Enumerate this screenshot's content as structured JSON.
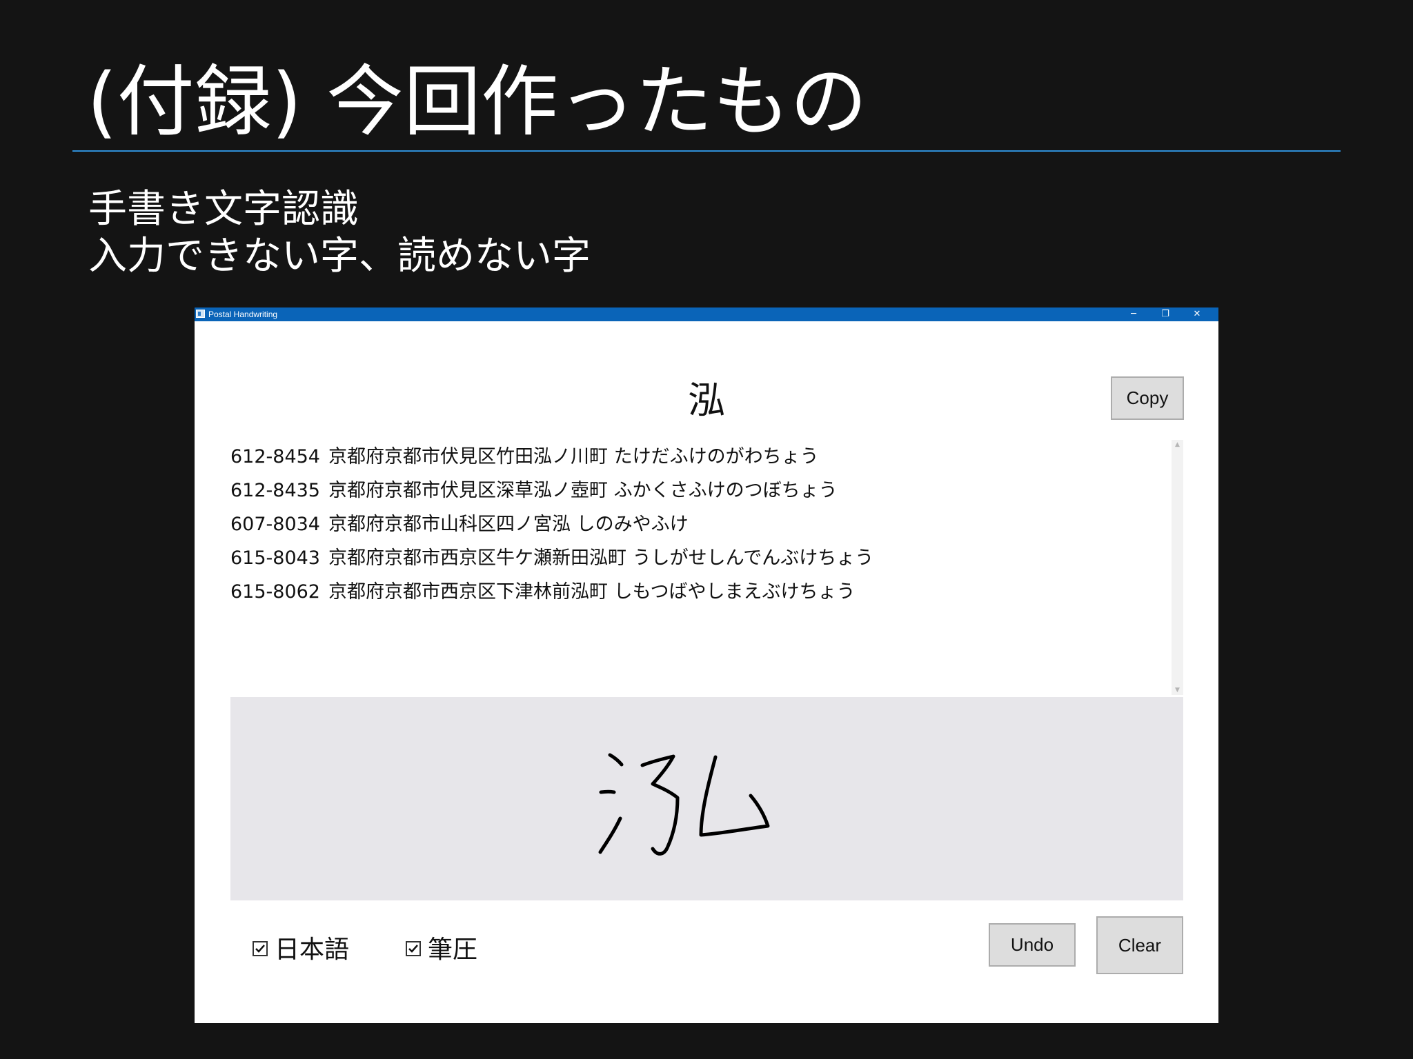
{
  "slide": {
    "title": "(付録) 今回作ったもの",
    "subtitle_lines": [
      "手書き文字認識",
      "入力できない字、読めない字"
    ]
  },
  "window": {
    "title": "Postal Handwriting",
    "controls": {
      "minimize": "─",
      "maximize": "❐",
      "close": "✕"
    }
  },
  "app": {
    "recognized_character": "泓",
    "copy_label": "Copy",
    "results": [
      {
        "code": "612-8454",
        "address": "京都府京都市伏見区竹田泓ノ川町 たけだふけのがわちょう"
      },
      {
        "code": "612-8435",
        "address": "京都府京都市伏見区深草泓ノ壺町 ふかくさふけのつぼちょう"
      },
      {
        "code": "607-8034",
        "address": "京都府京都市山科区四ノ宮泓 しのみやふけ"
      },
      {
        "code": "615-8043",
        "address": "京都府京都市西京区牛ケ瀬新田泓町 うしがせしんでんぶけちょう"
      },
      {
        "code": "615-8062",
        "address": "京都府京都市西京区下津林前泓町 しもつばやしまえぶけちょう"
      }
    ],
    "options": {
      "japanese": {
        "label": "日本語",
        "checked": true
      },
      "pressure": {
        "label": "筆圧",
        "checked": true
      }
    },
    "undo_label": "Undo",
    "clear_label": "Clear"
  },
  "colors": {
    "slide_background": "#141414",
    "title_rule": "#2f8fd8",
    "titlebar": "#0a64b8",
    "ink_canvas": "#e7e6ea"
  },
  "icons": [
    "app-icon",
    "minimize-icon",
    "maximize-icon",
    "close-icon",
    "checkbox-checked-icon"
  ]
}
